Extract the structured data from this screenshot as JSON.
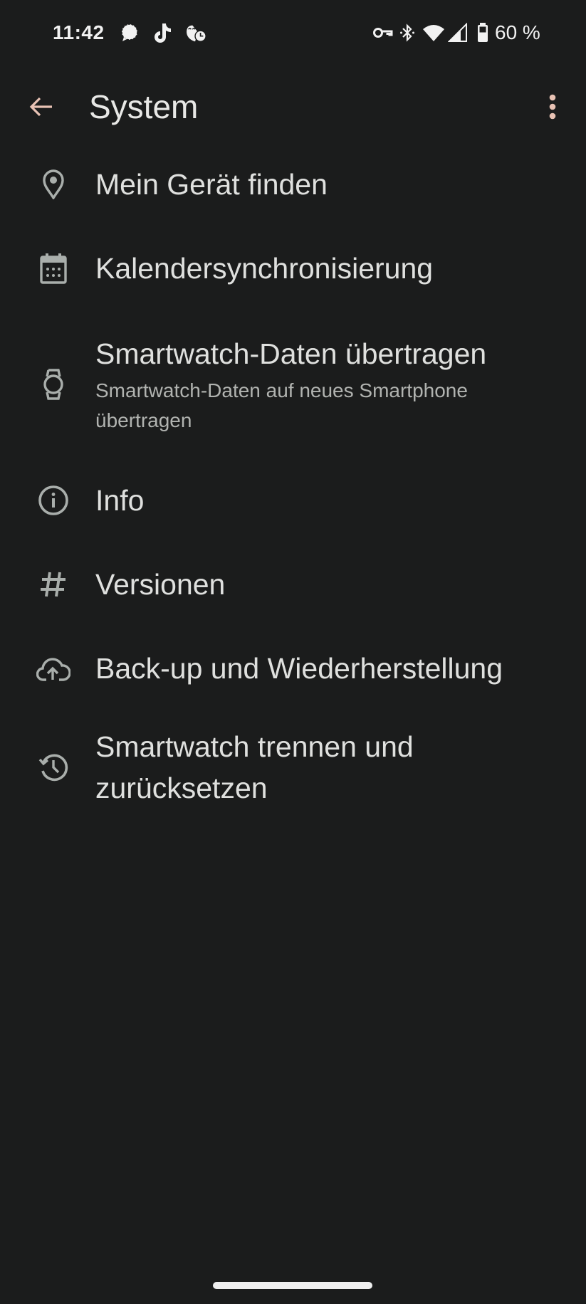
{
  "status_bar": {
    "time": "11:42",
    "notification_icons": [
      "signal-messenger-icon",
      "tiktok-icon",
      "sleep-clock-icon"
    ],
    "system_icons": [
      "vpn-key-icon",
      "bluetooth-icon",
      "wifi-icon",
      "cellular-signal-icon",
      "battery-icon"
    ],
    "battery_percent": "60 %"
  },
  "app_bar": {
    "title": "System",
    "back_icon": "arrow-back-icon",
    "more_icon": "more-vert-icon"
  },
  "items": [
    {
      "icon": "location-pin-icon",
      "title": "Mein Gerät finden"
    },
    {
      "icon": "calendar-icon",
      "title": "Kalendersynchronisierung"
    },
    {
      "icon": "watch-icon",
      "title": "Smartwatch-Daten übertragen",
      "subtitle": "Smartwatch-Daten auf neues Smartphone übertragen"
    },
    {
      "icon": "info-icon",
      "title": "Info"
    },
    {
      "icon": "hash-icon",
      "title": "Versionen"
    },
    {
      "icon": "cloud-upload-icon",
      "title": "Back-up und Wiederherstellung"
    },
    {
      "icon": "history-icon",
      "title": "Smartwatch trennen und zurücksetzen"
    }
  ],
  "colors": {
    "background": "#1b1c1c",
    "accent": "#e8c2b4",
    "text_primary": "#dfe0de",
    "text_secondary": "#b1b3b0",
    "icon": "#a9aeab"
  }
}
